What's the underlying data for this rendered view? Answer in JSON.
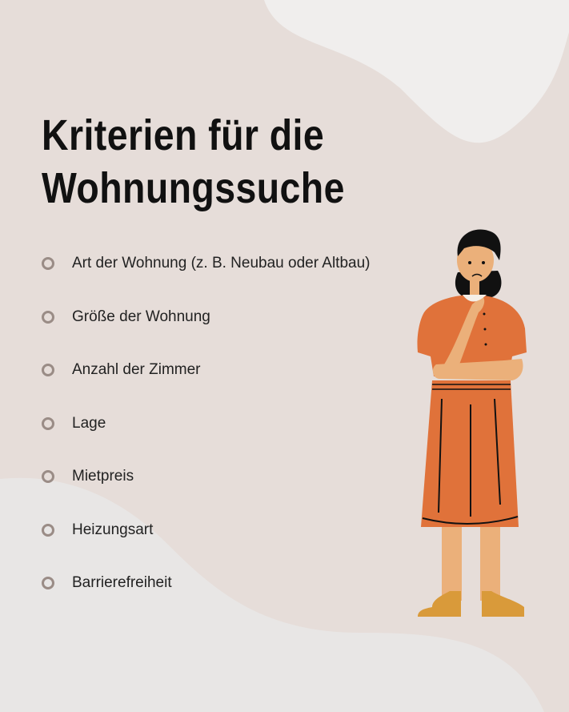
{
  "title": {
    "line1": "Kriterien für die",
    "line2": "Wohnungssuche"
  },
  "items": [
    {
      "label": "Art der Wohnung (z. B. Neubau oder Altbau)"
    },
    {
      "label": "Größe der Wohnung"
    },
    {
      "label": "Anzahl der Zimmer"
    },
    {
      "label": "Lage"
    },
    {
      "label": "Mietpreis"
    },
    {
      "label": "Heizungsart"
    },
    {
      "label": "Barrierefreiheit"
    }
  ],
  "colors": {
    "background": "#e6ddd9",
    "blob_top": "#f0eeed",
    "blob_bottom": "#e8e6e5",
    "bullet": "#9a8c86",
    "dress": "#e0723a",
    "skin": "#ebb07a",
    "shoes": "#d99a3a"
  }
}
